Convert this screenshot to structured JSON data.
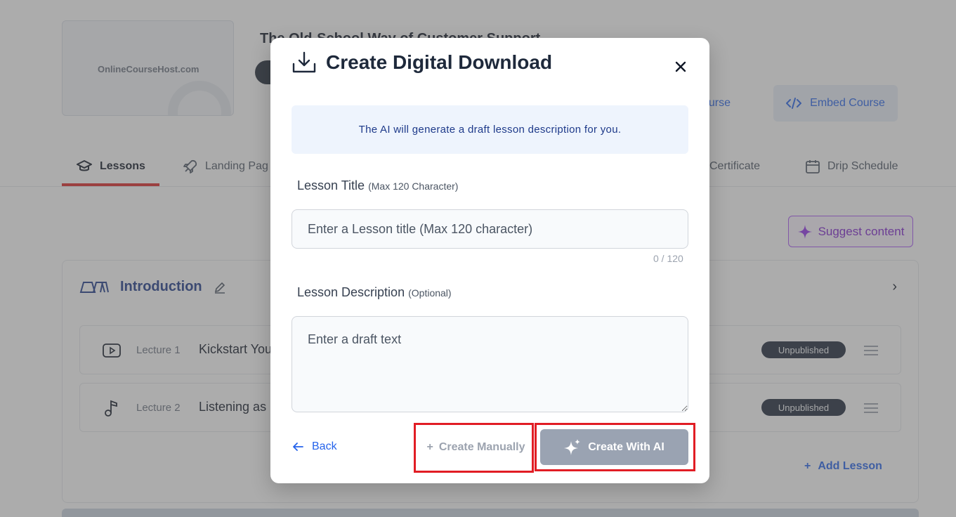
{
  "background": {
    "thumbnail_logo": "OnlineCourseHost.com",
    "course_title": "The Old-School Way of Customer Support",
    "course_button": "ourse",
    "embed_button": "Embed Course",
    "tabs": [
      {
        "label": "Lessons",
        "icon": "graduation-cap-icon"
      },
      {
        "label": "Landing Pag",
        "icon": "rocket-icon"
      },
      {
        "label": "Certificate",
        "icon": "certificate-icon"
      },
      {
        "label": "Drip Schedule",
        "icon": "calendar-icon"
      }
    ],
    "suggest_button": "Suggest content",
    "section": {
      "title": "Introduction",
      "lectures": [
        {
          "label": "Lecture 1",
          "title": "Kickstart You",
          "status": "Unpublished",
          "icon": "video-icon"
        },
        {
          "label": "Lecture 2",
          "title": "Listening as",
          "status": "Unpublished",
          "icon": "music-note-icon"
        }
      ],
      "add_lesson": "Add Lesson"
    }
  },
  "modal": {
    "title": "Create Digital Download",
    "info_text": "The AI will generate a draft lesson description for you.",
    "lesson_title_label": "Lesson Title",
    "lesson_title_hint": "(Max 120 Character)",
    "lesson_title_placeholder": "Enter a Lesson title (Max 120 character)",
    "counter": "0 / 120",
    "description_label": "Lesson Description",
    "description_hint": "(Optional)",
    "description_placeholder": "Enter a draft text",
    "back_label": "Back",
    "create_manually_label": "Create Manually",
    "create_ai_label": "Create With AI"
  },
  "colors": {
    "accent": "#2563eb",
    "highlight": "#e11d24",
    "ai_button": "#9aa3b2"
  }
}
